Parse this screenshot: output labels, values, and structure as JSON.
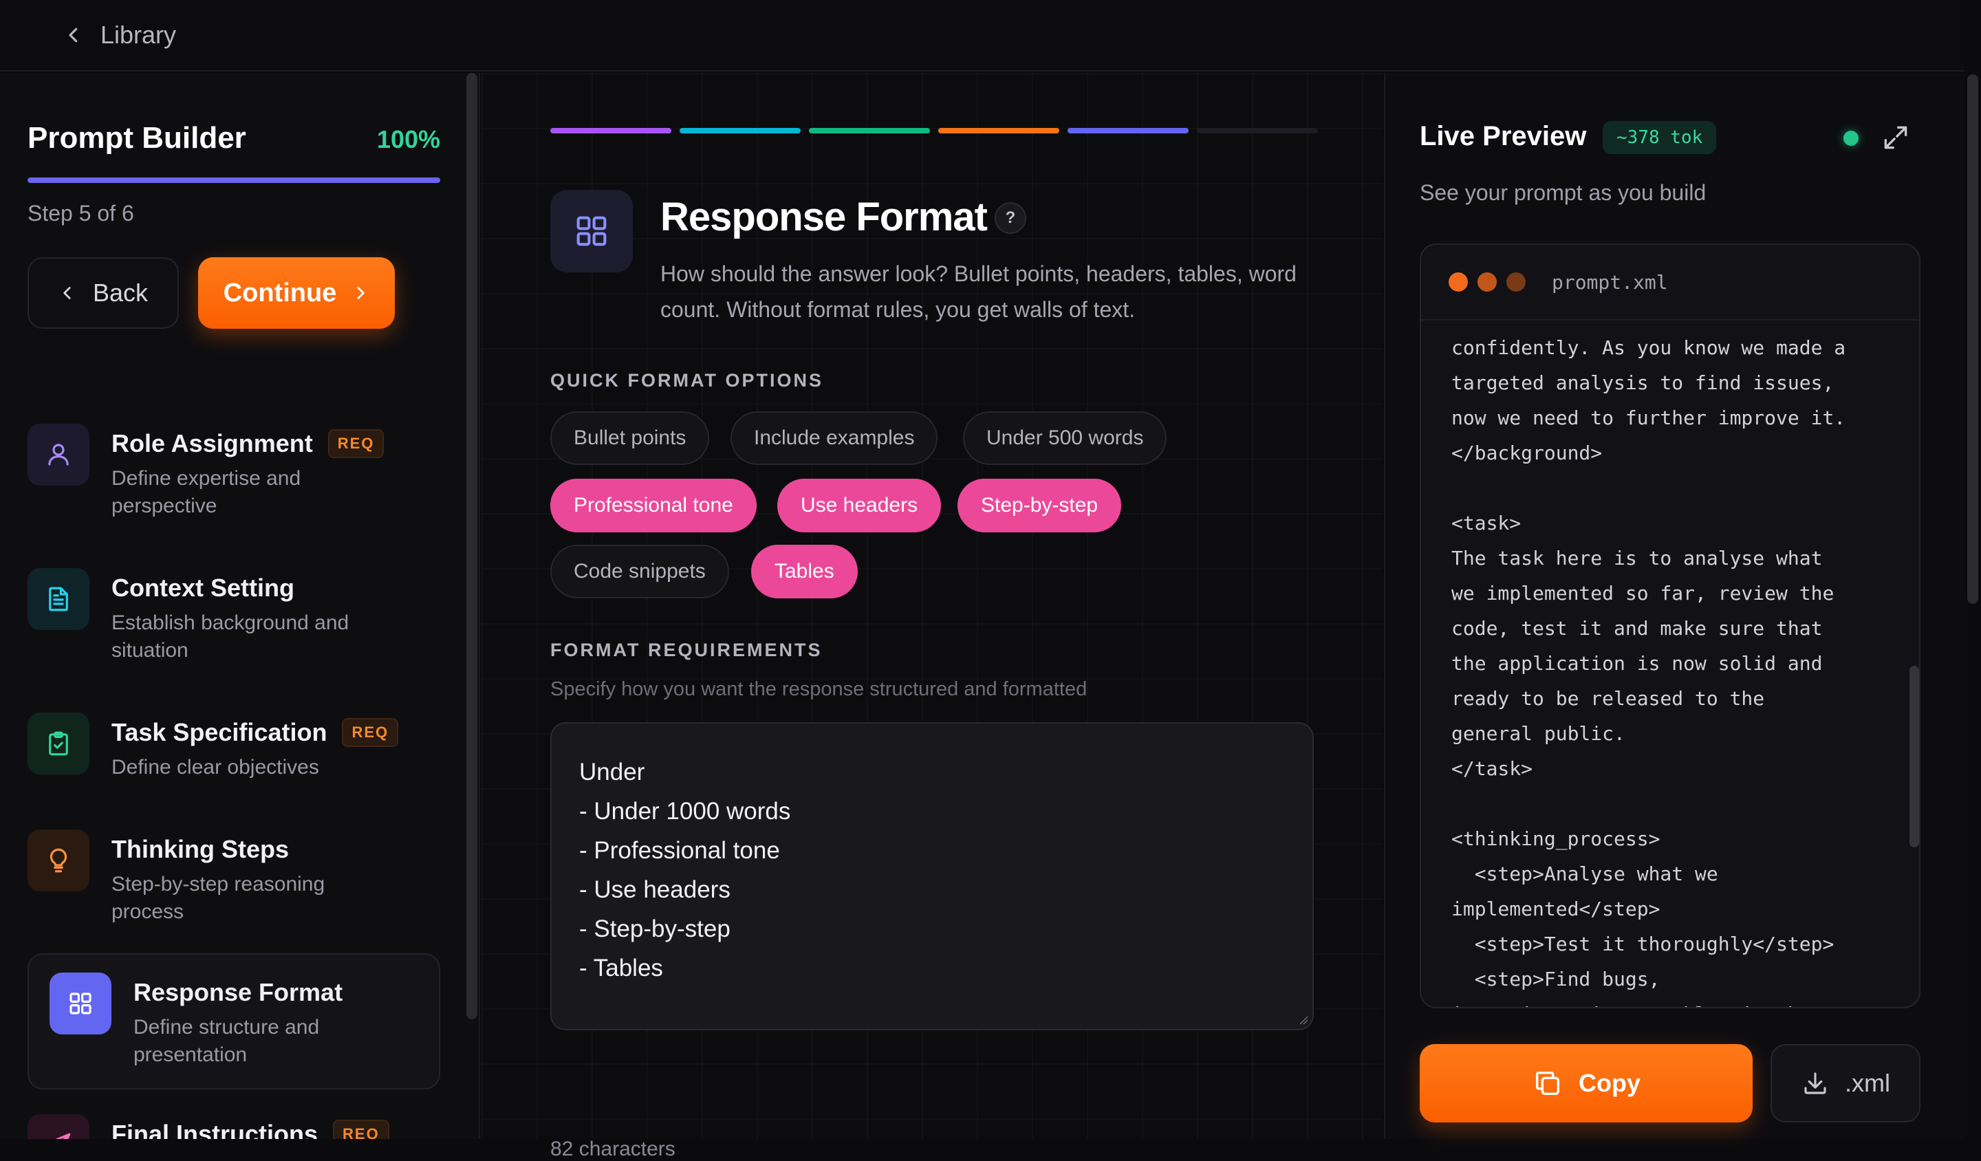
{
  "topbar": {
    "back_label": "Library"
  },
  "sidebar": {
    "title": "Prompt Builder",
    "percent": "100%",
    "progress": 1.0,
    "step_text": "Step 5 of 6",
    "back_label": "Back",
    "continue_label": "Continue",
    "items": [
      {
        "title": "Role Assignment",
        "badge": "REQ",
        "desc": "Define expertise and perspective",
        "icon": "user-icon",
        "color": "#a78bfa",
        "bg": "#1d1a2e"
      },
      {
        "title": "Context Setting",
        "badge": "",
        "desc": "Establish background and situation",
        "icon": "document-icon",
        "color": "#22d3ee",
        "bg": "#0f2429"
      },
      {
        "title": "Task Specification",
        "badge": "REQ",
        "desc": "Define clear objectives",
        "icon": "clipboard-check-icon",
        "color": "#34d399",
        "bg": "#10261d"
      },
      {
        "title": "Thinking Steps",
        "badge": "",
        "desc": "Step-by-step reasoning process",
        "icon": "lightbulb-icon",
        "color": "#fb923c",
        "bg": "#2a1a10"
      },
      {
        "title": "Response Format",
        "badge": "",
        "desc": "Define structure and presentation",
        "icon": "grid-icon",
        "color": "#ffffff",
        "bg": "#6366f1"
      },
      {
        "title": "Final Instructions",
        "badge": "REQ",
        "desc": "",
        "icon": "send-icon",
        "color": "#f472b6",
        "bg": "#2a1220"
      }
    ]
  },
  "center": {
    "segments": [
      "#a855f7",
      "#06b6d4",
      "#10b981",
      "#f97316",
      "#6366f1",
      "#1c1c22"
    ],
    "title": "Response Format",
    "help": "?",
    "desc": "How should the answer look? Bullet points, headers, tables, word count. Without format rules, you get walls of text.",
    "quick_label": "QUICK FORMAT OPTIONS",
    "chips": [
      {
        "label": "Bullet points",
        "on": false
      },
      {
        "label": "Include examples",
        "on": false
      },
      {
        "label": "Under 500 words",
        "on": false
      },
      {
        "label": "Professional tone",
        "on": true
      },
      {
        "label": "Use headers",
        "on": true
      },
      {
        "label": "Step-by-step",
        "on": true
      },
      {
        "label": "Code snippets",
        "on": false
      },
      {
        "label": "Tables",
        "on": true
      }
    ],
    "req_label": "FORMAT REQUIREMENTS",
    "req_help": "Specify how you want the response structured and formatted",
    "textarea_lines": [
      "Under",
      "- Under 1000 words",
      "- Professional tone",
      "- Use headers",
      "- Step-by-step",
      "- Tables"
    ],
    "char_count": "82 characters"
  },
  "preview": {
    "title": "Live Preview",
    "tokens": "~378 tok",
    "subtitle": "See your prompt as you build",
    "filename": "prompt.xml",
    "code_lines": [
      "confidently. As you know we made a",
      "targeted analysis to find issues,",
      "now we need to further improve it.",
      "</background>",
      "",
      "<task>",
      "The task here is to analyse what",
      "we implemented so far, review the",
      "code, test it and make sure that",
      "the application is now solid and",
      "ready to be released to the",
      "general public.",
      "</task>",
      "",
      "<thinking_process>",
      "  <step>Analyse what we",
      "implemented</step>",
      "  <step>Test it thoroughly</step>",
      "  <step>Find bugs,",
      "inconsistencies, problem in the"
    ],
    "copy_label": "Copy",
    "download_label": ".xml"
  }
}
